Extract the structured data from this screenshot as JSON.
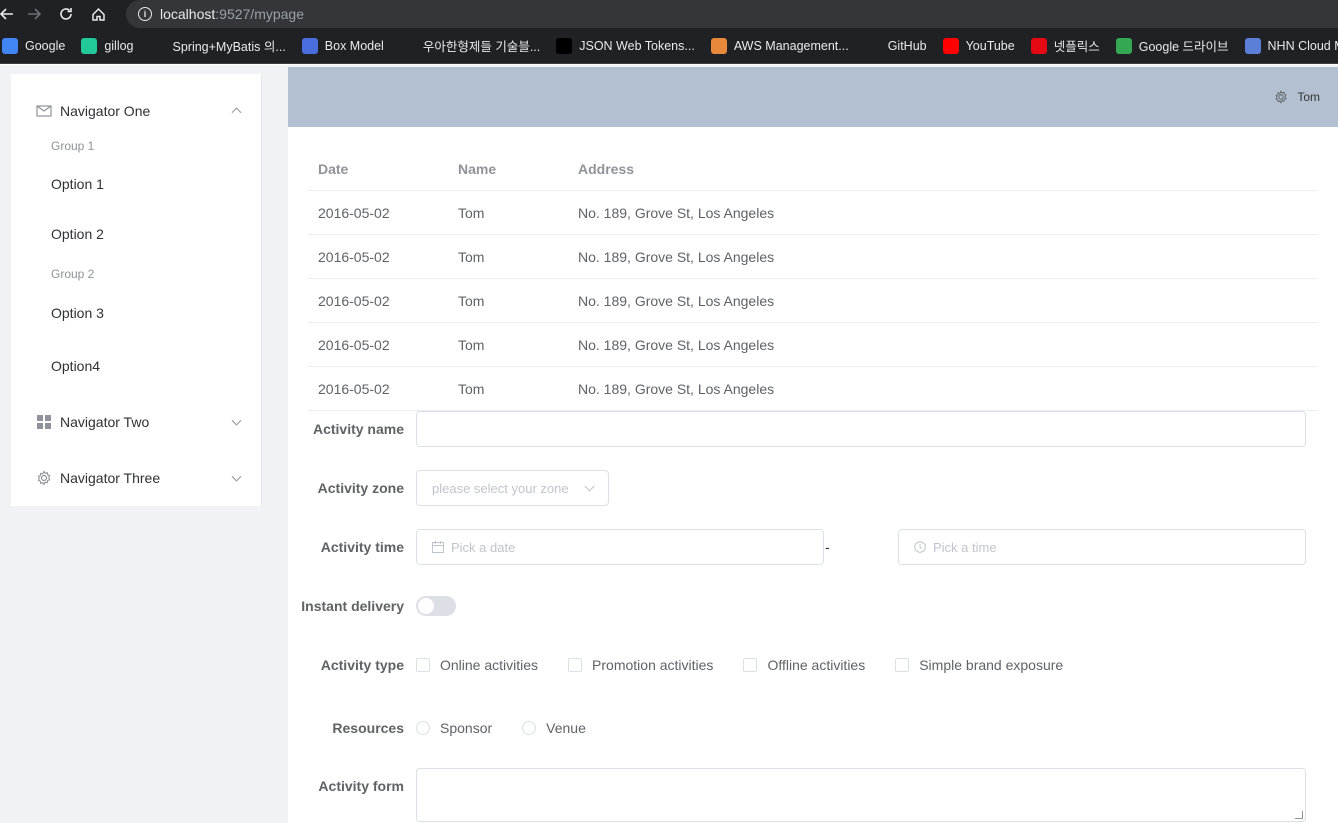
{
  "browser": {
    "url_host": "localhost",
    "url_path": ":9527/mypage",
    "bookmarks": [
      {
        "label": "Google",
        "icon": "google-icon",
        "color": "#4285f4"
      },
      {
        "label": "gillog",
        "icon": "velog-icon",
        "color": "#20c997"
      },
      {
        "label": "Spring+MyBatis 의...",
        "icon": "tistory-icon",
        "color": "#202124"
      },
      {
        "label": "Box Model",
        "icon": "play-icon",
        "color": "#4a6ee0"
      },
      {
        "label": "우아한형제들 기술블...",
        "icon": "woowa-icon",
        "color": "#202124"
      },
      {
        "label": "JSON Web Tokens...",
        "icon": "jwt-icon",
        "color": "#000000"
      },
      {
        "label": "AWS Management...",
        "icon": "aws-icon",
        "color": "#e8883a"
      },
      {
        "label": "GitHub",
        "icon": "github-icon",
        "color": "#202124"
      },
      {
        "label": "YouTube",
        "icon": "youtube-icon",
        "color": "#ff0000"
      },
      {
        "label": "넷플릭스",
        "icon": "netflix-icon",
        "color": "#e50914"
      },
      {
        "label": "Google 드라이브",
        "icon": "drive-icon",
        "color": "#34a853"
      },
      {
        "label": "NHN Cloud Me",
        "icon": "nhn-icon",
        "color": "#5b7fd6"
      }
    ]
  },
  "sidebar": {
    "nav_one": "Navigator One",
    "group1": "Group 1",
    "option1": "Option 1",
    "option2": "Option 2",
    "group2": "Group 2",
    "option3": "Option 3",
    "option4": "Option4",
    "nav_two": "Navigator Two",
    "nav_three": "Navigator Three"
  },
  "header": {
    "user": "Tom"
  },
  "table": {
    "columns": [
      "Date",
      "Name",
      "Address"
    ],
    "rows": [
      [
        "2016-05-02",
        "Tom",
        "No. 189, Grove St, Los Angeles"
      ],
      [
        "2016-05-02",
        "Tom",
        "No. 189, Grove St, Los Angeles"
      ],
      [
        "2016-05-02",
        "Tom",
        "No. 189, Grove St, Los Angeles"
      ],
      [
        "2016-05-02",
        "Tom",
        "No. 189, Grove St, Los Angeles"
      ],
      [
        "2016-05-02",
        "Tom",
        "No. 189, Grove St, Los Angeles"
      ]
    ]
  },
  "form": {
    "name_label": "Activity name",
    "name_value": "",
    "zone_label": "Activity zone",
    "zone_placeholder": "please select your zone",
    "time_label": "Activity time",
    "date_placeholder": "Pick a date",
    "time_separator": "-",
    "time_placeholder": "Pick a time",
    "delivery_label": "Instant delivery",
    "delivery_on": false,
    "type_label": "Activity type",
    "types": [
      "Online activities",
      "Promotion activities",
      "Offline activities",
      "Simple brand exposure"
    ],
    "resources_label": "Resources",
    "resources": [
      "Sponsor",
      "Venue"
    ],
    "form_label": "Activity form",
    "form_value": ""
  }
}
